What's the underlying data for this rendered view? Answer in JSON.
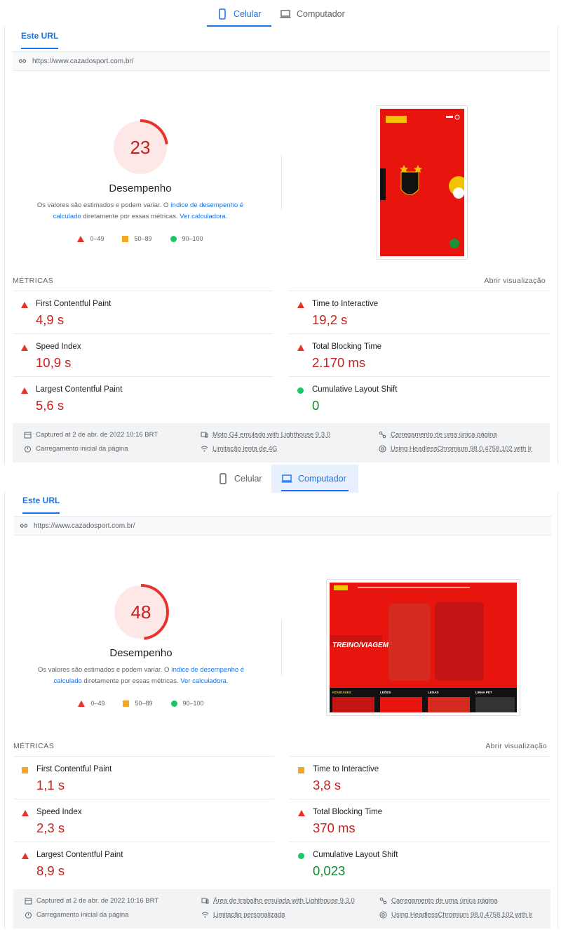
{
  "tabs": {
    "mobile": "Celular",
    "desktop": "Computador"
  },
  "url_tab": "Este URL",
  "url": "https://www.cazadosport.com.br/",
  "score_label": "Desempenho",
  "desc": {
    "part1": "Os valores são estimados e podem variar. O ",
    "link1": "índice de desempenho é calculado",
    "part2": " diretamente por essas métricas. ",
    "link2": "Ver calculadora",
    "part3": "."
  },
  "legend": {
    "red": "0–49",
    "orange": "50–89",
    "green": "90–100"
  },
  "metrics_title": "MÉTRICAS",
  "open_view": "Abrir visualização",
  "metric_names": {
    "fcp": "First Contentful Paint",
    "tti": "Time to Interactive",
    "si": "Speed Index",
    "tbt": "Total Blocking Time",
    "lcp": "Largest Contentful Paint",
    "cls": "Cumulative Layout Shift"
  },
  "colors": {
    "red": "#e8332b",
    "orange": "#f5a623",
    "green": "#18c964",
    "accent": "#1a73e8"
  },
  "mobile": {
    "score": "23",
    "score_fraction": 0.23,
    "metrics": {
      "fcp": "4,9 s",
      "tti": "19,2 s",
      "si": "10,9 s",
      "tbt": "2.170 ms",
      "lcp": "5,6 s",
      "cls": "0"
    },
    "footer": {
      "captured": "Captured at 2 de abr. de 2022 10:16 BRT",
      "initial": "Carregamento inicial da página",
      "device": "Moto G4 emulado with Lighthouse 9.3.0",
      "throttle": "Limitação lenta de 4G",
      "single": "Carregamento de uma única página",
      "browser": "Using HeadlessChromium 98.0.4758.102 with lr"
    }
  },
  "desktop": {
    "score": "48",
    "score_fraction": 0.48,
    "metrics": {
      "fcp": "1,1 s",
      "tti": "3,8 s",
      "si": "2,3 s",
      "tbt": "370 ms",
      "lcp": "8,9 s",
      "cls": "0,023"
    },
    "footer": {
      "captured": "Captured at 2 de abr. de 2022 10:16 BRT",
      "initial": "Carregamento inicial da página",
      "device": "Área de trabalho emulada with Lighthouse 9.3.0",
      "throttle": "Limitação personalizada",
      "single": "Carregamento de uma única página",
      "browser": "Using HeadlessChromium 98.0.4758.102 with lr"
    }
  },
  "desktop_shot": {
    "banner": "TREINO/VIAGEM",
    "nav": [
      "NOVIDADES",
      "LEÕES",
      "LEOAS",
      "LINHA PET"
    ]
  }
}
